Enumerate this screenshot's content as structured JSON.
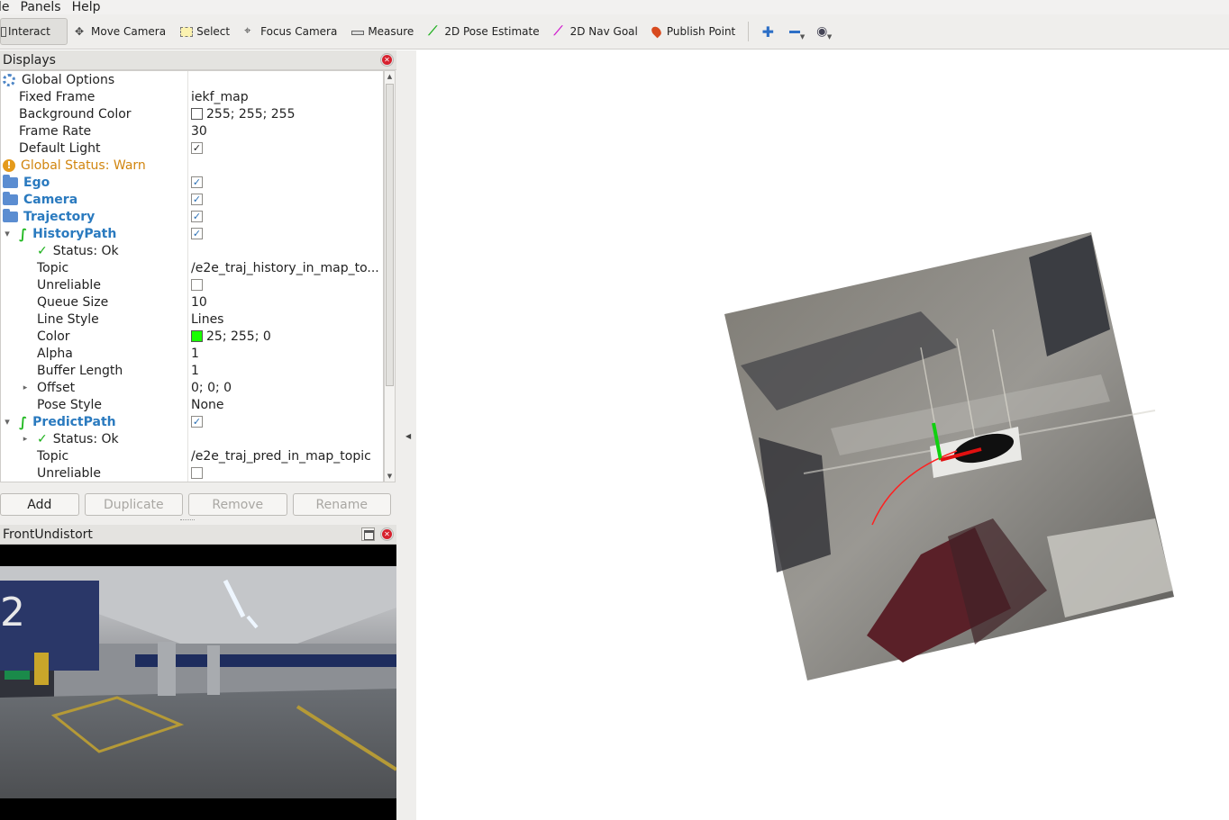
{
  "menu": [
    "le",
    "Panels",
    "Help"
  ],
  "toolbar": {
    "tools": [
      {
        "label": "Interact",
        "icon": "cursor-icon",
        "active": true
      },
      {
        "label": "Move Camera",
        "icon": "move-arrows-icon"
      },
      {
        "label": "Select",
        "icon": "select-rect-icon"
      },
      {
        "label": "Focus Camera",
        "icon": "focus-target-icon"
      },
      {
        "label": "Measure",
        "icon": "ruler-icon"
      },
      {
        "label": "2D Pose Estimate",
        "icon": "green-arrow-icon"
      },
      {
        "label": "2D Nav Goal",
        "icon": "magenta-arrow-icon"
      },
      {
        "label": "Publish Point",
        "icon": "map-pin-icon"
      }
    ],
    "icon_buttons": [
      "add-tool-icon",
      "remove-tool-icon",
      "eye-view-icon"
    ]
  },
  "displays": {
    "title": "Displays",
    "rows": [
      {
        "name": "Global Options",
        "value": "",
        "type": "gear",
        "indent": 0
      },
      {
        "name": "Fixed Frame",
        "value": "iekf_map",
        "indent": 1
      },
      {
        "name": "Background Color",
        "value": "255; 255; 255",
        "swatch": "#ffffff",
        "indent": 1
      },
      {
        "name": "Frame Rate",
        "value": "30",
        "indent": 1
      },
      {
        "name": "Default Light",
        "value": "",
        "checkbox": true,
        "indent": 1
      },
      {
        "name": "Global Status: Warn",
        "value": "",
        "type": "warn",
        "indent": 0
      },
      {
        "name": "Ego",
        "value": "",
        "type": "folder",
        "checkbox": true,
        "indent": 0
      },
      {
        "name": "Camera",
        "value": "",
        "type": "folder",
        "checkbox": true,
        "indent": 0
      },
      {
        "name": "Trajectory",
        "value": "",
        "type": "folder",
        "checkbox": true,
        "indent": 0
      },
      {
        "name": "HistoryPath",
        "value": "",
        "type": "path",
        "checkbox": true,
        "expanded": true,
        "indent": 0
      },
      {
        "name": "Status: Ok",
        "value": "",
        "type": "ok",
        "indent": 2
      },
      {
        "name": "Topic",
        "value": "/e2e_traj_history_in_map_to...",
        "indent": 2
      },
      {
        "name": "Unreliable",
        "value": "",
        "checkbox": false,
        "indent": 2
      },
      {
        "name": "Queue Size",
        "value": "10",
        "indent": 2
      },
      {
        "name": "Line Style",
        "value": "Lines",
        "indent": 2
      },
      {
        "name": "Color",
        "value": "25; 255; 0",
        "swatch": "#19ff00",
        "indent": 2
      },
      {
        "name": "Alpha",
        "value": "1",
        "indent": 2
      },
      {
        "name": "Buffer Length",
        "value": "1",
        "indent": 2
      },
      {
        "name": "Offset",
        "value": "0; 0; 0",
        "collapsed": true,
        "indent": 2
      },
      {
        "name": "Pose Style",
        "value": "None",
        "indent": 2
      },
      {
        "name": "PredictPath",
        "value": "",
        "type": "path",
        "checkbox": true,
        "expanded": true,
        "indent": 0
      },
      {
        "name": "Status: Ok",
        "value": "",
        "type": "ok",
        "collapsed": true,
        "indent": 2
      },
      {
        "name": "Topic",
        "value": "/e2e_traj_pred_in_map_topic",
        "indent": 2
      },
      {
        "name": "Unreliable",
        "value": "",
        "checkbox": false,
        "indent": 2
      }
    ]
  },
  "buttons": {
    "add": "Add",
    "duplicate": "Duplicate",
    "remove": "Remove",
    "rename": "Rename"
  },
  "camera_panel": {
    "title": "FrontUndistort"
  },
  "colors": {
    "path_green": "#19ff00",
    "link_blue": "#2a7abf",
    "warn_orange": "#d1850e"
  }
}
